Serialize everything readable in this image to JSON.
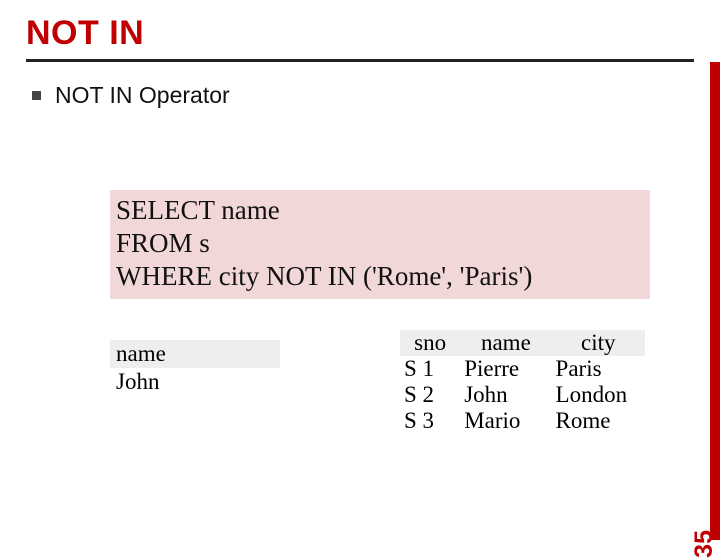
{
  "slide": {
    "title": "NOT IN",
    "subtitle": "NOT IN Operator",
    "page_number": "35"
  },
  "sql": {
    "line1": "SELECT name",
    "line2": " FROM s",
    "line3": "WHERE city NOT IN ('Rome', 'Paris')"
  },
  "result_table": {
    "header": "name",
    "rows": [
      "John"
    ]
  },
  "source_table": {
    "headers": {
      "c0": "sno",
      "c1": "name",
      "c2": "city"
    },
    "rows": [
      {
        "sno": "S 1",
        "name": "Pierre",
        "city": "Paris"
      },
      {
        "sno": "S 2",
        "name": "John",
        "city": "London"
      },
      {
        "sno": "S 3",
        "name": "Mario",
        "city": "Rome"
      }
    ]
  }
}
